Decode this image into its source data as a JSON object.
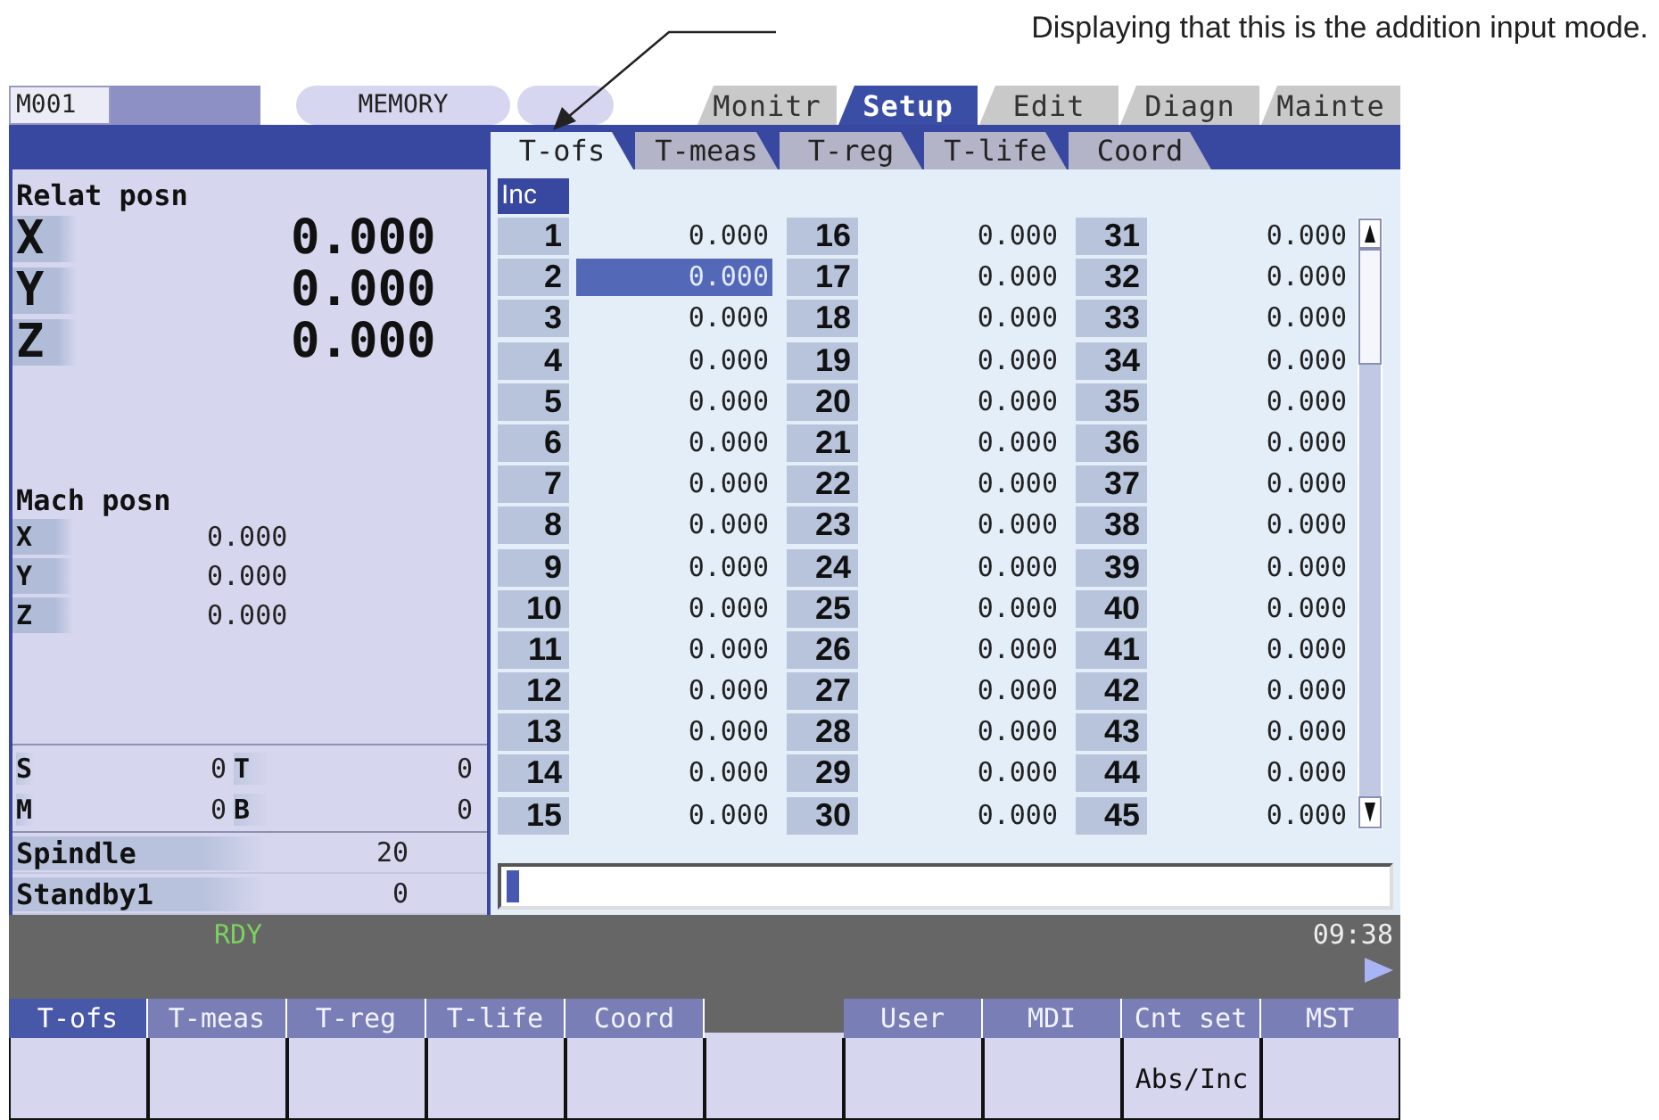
{
  "annotation": "Displaying that this is the addition input mode.",
  "status": {
    "program": "M001",
    "mode": "MEMORY"
  },
  "main_tabs": [
    {
      "label": "Monitr",
      "selected": false
    },
    {
      "label": "Setup",
      "selected": true
    },
    {
      "label": "Edit",
      "selected": false
    },
    {
      "label": "Diagn",
      "selected": false
    },
    {
      "label": "Mainte",
      "selected": false
    }
  ],
  "sub_tabs": [
    {
      "label": "T-ofs",
      "selected": true
    },
    {
      "label": "T-meas",
      "selected": false
    },
    {
      "label": "T-reg",
      "selected": false
    },
    {
      "label": "T-life",
      "selected": false
    },
    {
      "label": "Coord",
      "selected": false
    }
  ],
  "relat_posn": {
    "title": "Relat posn",
    "axes": [
      {
        "axis": "X",
        "value": "0.000"
      },
      {
        "axis": "Y",
        "value": "0.000"
      },
      {
        "axis": "Z",
        "value": "0.000"
      }
    ]
  },
  "mach_posn": {
    "title": "Mach posn",
    "axes": [
      {
        "axis": "X",
        "value": "0.000"
      },
      {
        "axis": "Y",
        "value": "0.000"
      },
      {
        "axis": "Z",
        "value": "0.000"
      }
    ]
  },
  "modal": [
    {
      "label": "S",
      "value": "0"
    },
    {
      "label": "T",
      "value": "0"
    },
    {
      "label": "M",
      "value": "0"
    },
    {
      "label": "B",
      "value": "0"
    }
  ],
  "spindle": [
    {
      "label": "Spindle",
      "value": "20"
    },
    {
      "label": "Standby1",
      "value": "0"
    }
  ],
  "offsets": {
    "input_mode": "Inc",
    "rows": [
      {
        "no": "1",
        "value": "0.000",
        "selected": false
      },
      {
        "no": "2",
        "value": "0.000",
        "selected": true
      },
      {
        "no": "3",
        "value": "0.000",
        "selected": false
      },
      {
        "no": "4",
        "value": "0.000",
        "selected": false
      },
      {
        "no": "5",
        "value": "0.000",
        "selected": false
      },
      {
        "no": "6",
        "value": "0.000",
        "selected": false
      },
      {
        "no": "7",
        "value": "0.000",
        "selected": false
      },
      {
        "no": "8",
        "value": "0.000",
        "selected": false
      },
      {
        "no": "9",
        "value": "0.000",
        "selected": false
      },
      {
        "no": "10",
        "value": "0.000",
        "selected": false
      },
      {
        "no": "11",
        "value": "0.000",
        "selected": false
      },
      {
        "no": "12",
        "value": "0.000",
        "selected": false
      },
      {
        "no": "13",
        "value": "0.000",
        "selected": false
      },
      {
        "no": "14",
        "value": "0.000",
        "selected": false
      },
      {
        "no": "15",
        "value": "0.000",
        "selected": false
      },
      {
        "no": "16",
        "value": "0.000",
        "selected": false
      },
      {
        "no": "17",
        "value": "0.000",
        "selected": false
      },
      {
        "no": "18",
        "value": "0.000",
        "selected": false
      },
      {
        "no": "19",
        "value": "0.000",
        "selected": false
      },
      {
        "no": "20",
        "value": "0.000",
        "selected": false
      },
      {
        "no": "21",
        "value": "0.000",
        "selected": false
      },
      {
        "no": "22",
        "value": "0.000",
        "selected": false
      },
      {
        "no": "23",
        "value": "0.000",
        "selected": false
      },
      {
        "no": "24",
        "value": "0.000",
        "selected": false
      },
      {
        "no": "25",
        "value": "0.000",
        "selected": false
      },
      {
        "no": "26",
        "value": "0.000",
        "selected": false
      },
      {
        "no": "27",
        "value": "0.000",
        "selected": false
      },
      {
        "no": "28",
        "value": "0.000",
        "selected": false
      },
      {
        "no": "29",
        "value": "0.000",
        "selected": false
      },
      {
        "no": "30",
        "value": "0.000",
        "selected": false
      },
      {
        "no": "31",
        "value": "0.000",
        "selected": false
      },
      {
        "no": "32",
        "value": "0.000",
        "selected": false
      },
      {
        "no": "33",
        "value": "0.000",
        "selected": false
      },
      {
        "no": "34",
        "value": "0.000",
        "selected": false
      },
      {
        "no": "35",
        "value": "0.000",
        "selected": false
      },
      {
        "no": "36",
        "value": "0.000",
        "selected": false
      },
      {
        "no": "37",
        "value": "0.000",
        "selected": false
      },
      {
        "no": "38",
        "value": "0.000",
        "selected": false
      },
      {
        "no": "39",
        "value": "0.000",
        "selected": false
      },
      {
        "no": "40",
        "value": "0.000",
        "selected": false
      },
      {
        "no": "41",
        "value": "0.000",
        "selected": false
      },
      {
        "no": "42",
        "value": "0.000",
        "selected": false
      },
      {
        "no": "43",
        "value": "0.000",
        "selected": false
      },
      {
        "no": "44",
        "value": "0.000",
        "selected": false
      },
      {
        "no": "45",
        "value": "0.000",
        "selected": false
      }
    ]
  },
  "status_bar": {
    "state": "RDY",
    "time": "09:38"
  },
  "softkeys": [
    {
      "label": "T-ofs",
      "selected": true,
      "disabled": false
    },
    {
      "label": "T-meas",
      "selected": false,
      "disabled": true
    },
    {
      "label": "T-reg",
      "selected": false,
      "disabled": true
    },
    {
      "label": "T-life",
      "selected": false,
      "disabled": true
    },
    {
      "label": "Coord",
      "selected": false,
      "disabled": true
    },
    {
      "selected": false,
      "disabled": false
    },
    {
      "label": "User",
      "selected": false,
      "disabled": true
    },
    {
      "label": "MDI",
      "selected": false,
      "disabled": true
    },
    {
      "label": "Cnt set",
      "sub": "Abs/Inc",
      "selected": false,
      "disabled": true
    },
    {
      "label": "MST",
      "selected": false,
      "disabled": true
    }
  ]
}
